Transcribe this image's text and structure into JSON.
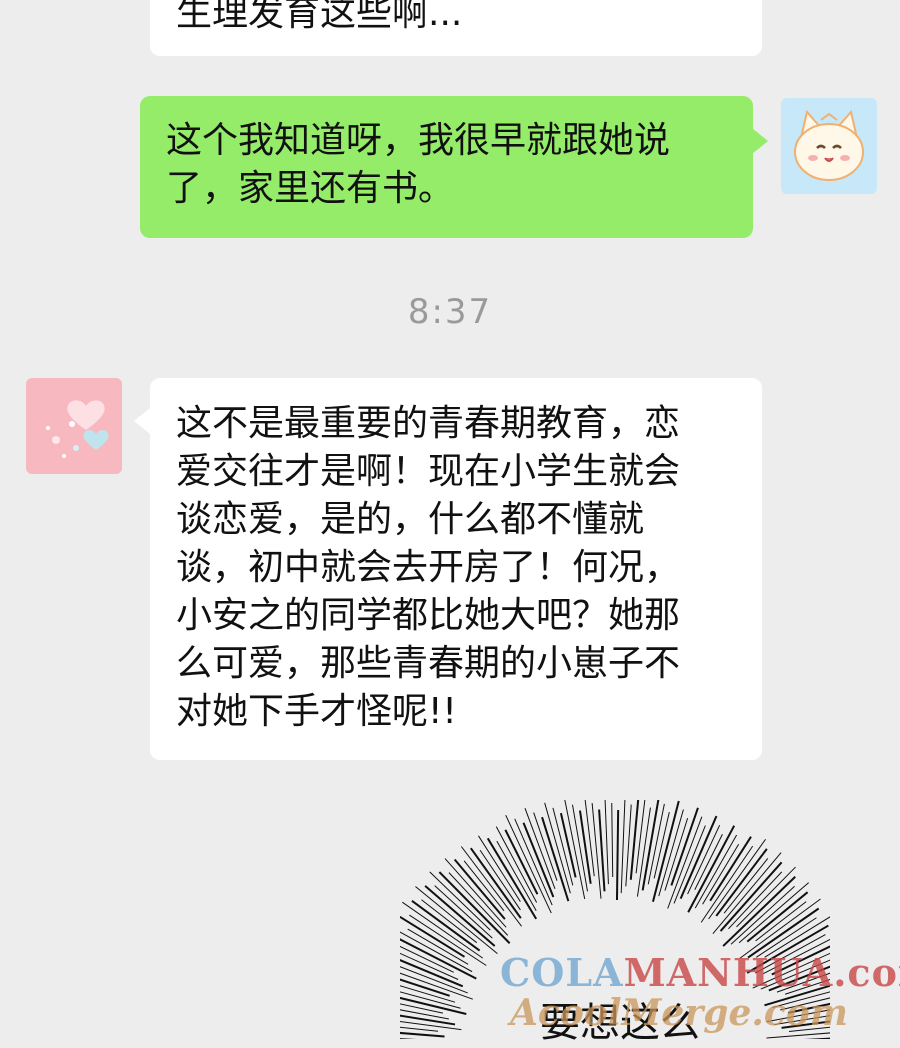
{
  "chat": {
    "messages": [
      {
        "side": "left",
        "text": "生理发育这些啊..."
      },
      {
        "side": "right",
        "lines": [
          "这个我知道呀，我很早就跟她说",
          "了，家里还有书。"
        ]
      },
      {
        "side": "left",
        "lines": [
          "这不是最重要的青春期教育，恋",
          "爱交往才是啊！现在小学生就会",
          "谈恋爱，是的，什么都不懂就",
          "谈，初中就会去开房了！何况，",
          "小安之的同学都比她大吧？她那",
          "么可爱，那些青春期的小崽子不",
          "对她下手才怪呢!!"
        ]
      }
    ],
    "timestamp": "8:37"
  },
  "panel": {
    "caption": "要想这么"
  },
  "watermark": {
    "line1_part1": "COLA",
    "line1_part2": "MANHUA",
    "line1_part3": ".com",
    "line2": "AcoolMerge.com"
  },
  "colors": {
    "background": "#ededed",
    "bubble_left": "#ffffff",
    "bubble_right": "#95ec69",
    "timestamp": "#9a9a9a"
  },
  "icons": {
    "self_avatar": "cat-avatar-icon",
    "friend_avatar": "hearts-avatar-icon"
  }
}
